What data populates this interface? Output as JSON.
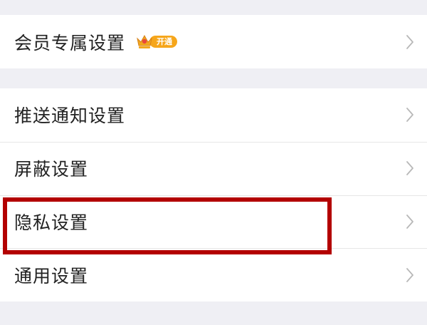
{
  "vip_section": {
    "label": "会员专属设置",
    "badge_text": "开通",
    "badge_color": "#f6a61b"
  },
  "settings": [
    {
      "id": "push",
      "label": "推送通知设置"
    },
    {
      "id": "block",
      "label": "屏蔽设置"
    },
    {
      "id": "privacy",
      "label": "隐私设置"
    },
    {
      "id": "general",
      "label": "通用设置"
    }
  ],
  "highlight": {
    "target": "privacy",
    "color": "#b30000"
  },
  "icons": {
    "chevron": "chevron-right-icon",
    "crown": "vip-crown-icon"
  }
}
